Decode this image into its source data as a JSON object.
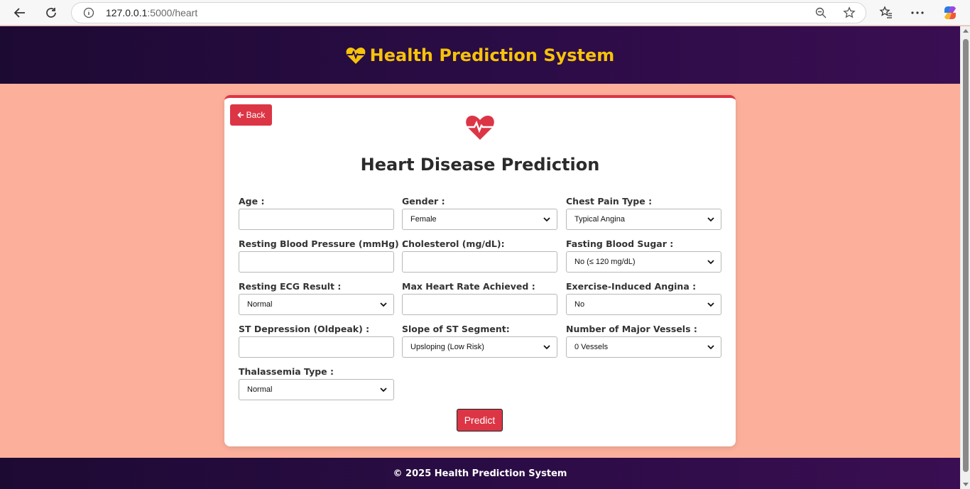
{
  "browser": {
    "url_host": "127.0.0.1",
    "url_path": ":5000/heart"
  },
  "header": {
    "title": "Health Prediction System",
    "icon": "heartbeat-icon",
    "accent_color": "#f6c20a"
  },
  "card": {
    "back_label": "Back",
    "title": "Heart Disease Prediction",
    "icon": "heartbeat-icon",
    "accent_color": "#dc3545"
  },
  "fields": {
    "age": {
      "label": "Age :",
      "value": ""
    },
    "gender": {
      "label": "Gender :",
      "selected": "Female"
    },
    "chest_pain": {
      "label": "Chest Pain Type :",
      "selected": "Typical Angina"
    },
    "resting_bp": {
      "label": "Resting Blood Pressure (mmHg) :",
      "value": ""
    },
    "cholesterol": {
      "label": "Cholesterol (mg/dL):",
      "value": ""
    },
    "fasting_sugar": {
      "label": "Fasting Blood Sugar :",
      "selected": "No (≤ 120 mg/dL)"
    },
    "resting_ecg": {
      "label": "Resting ECG Result :",
      "selected": "Normal"
    },
    "max_hr": {
      "label": "Max Heart Rate Achieved :",
      "value": ""
    },
    "exercise_angina": {
      "label": "Exercise-Induced Angina :",
      "selected": "No"
    },
    "st_depression": {
      "label": "ST Depression (Oldpeak) :",
      "value": ""
    },
    "st_slope": {
      "label": "Slope of ST Segment:",
      "selected": "Upsloping (Low Risk)"
    },
    "major_vessels": {
      "label": "Number of Major Vessels :",
      "selected": "0 Vessels"
    },
    "thalassemia": {
      "label": "Thalassemia Type :",
      "selected": "Normal"
    }
  },
  "predict_label": "Predict",
  "footer": {
    "text": "© 2025 Health Prediction System"
  }
}
